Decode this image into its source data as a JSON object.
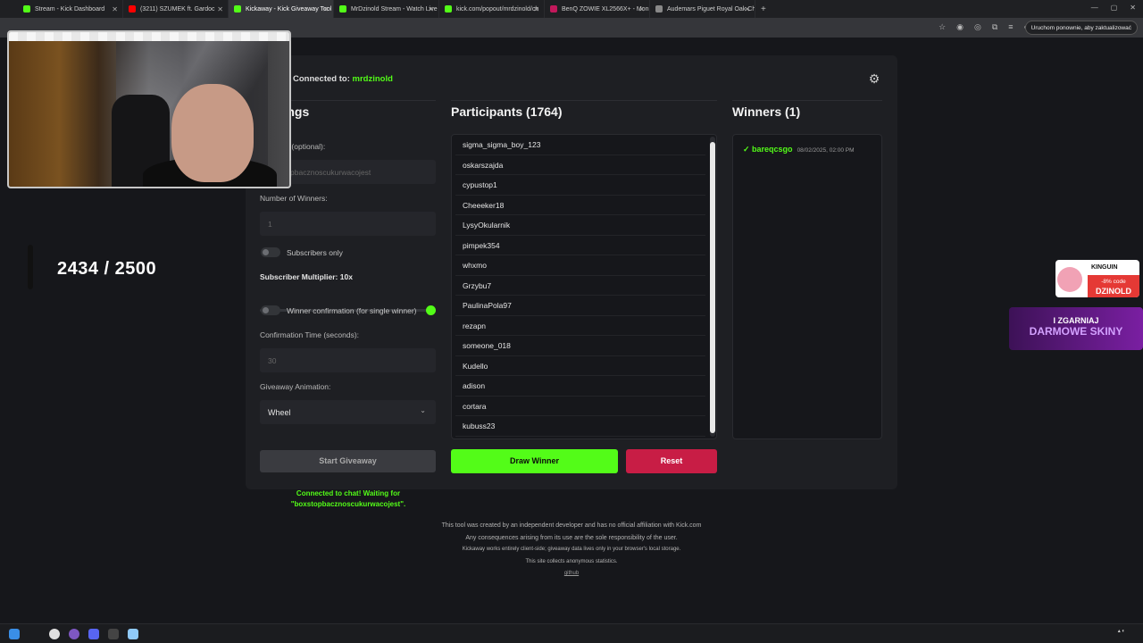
{
  "browser": {
    "tabs": [
      {
        "label": "Stream - Kick Dashboard",
        "color": "#53fc18",
        "active": false
      },
      {
        "label": "(3211) SZUMEK ft. Gardoc",
        "color": "#ff0000",
        "active": false
      },
      {
        "label": "Kickaway - Kick Giveaway Tool",
        "color": "#53fc18",
        "active": true
      },
      {
        "label": "MrDzinold Stream - Watch Live",
        "color": "#53fc18",
        "active": false
      },
      {
        "label": "kick.com/popout/mrdzinold/ch",
        "color": "#53fc18",
        "active": false
      },
      {
        "label": "BenQ ZOWIE XL2566X+ - Moni",
        "color": "#c2185b",
        "active": false
      },
      {
        "label": "Audemars Piguet Royal Oak Ch",
        "color": "#888888",
        "active": false
      }
    ],
    "update_button": "Uruchom ponownie, aby zaktualizować"
  },
  "app": {
    "connected_prefix": "Connected to: ",
    "channel": "mrdzinold",
    "settings_title": "Settings",
    "keyword_label": "Keyword (optional):",
    "keyword_value": "boxstopbacznoscukurwacojest",
    "winners_label": "Number of Winners:",
    "winners_value": "1",
    "subscribers_only": "Subscribers only",
    "multiplier_label": "Subscriber Multiplier: 10x",
    "multiplier_fraction": 1.0,
    "winner_confirmation": "Winner confirmation (for single winner)",
    "confirmation_time_label": "Confirmation Time (seconds):",
    "confirmation_time_value": "30",
    "animation_label": "Giveaway Animation:",
    "animation_value": "Wheel",
    "start_button": "Start Giveaway",
    "status": "Connected to chat! Waiting for \"boxstopbacznoscukurwacojest\".",
    "participants_title": "Participants (1764)",
    "participants": [
      "sigma_sigma_boy_123",
      "oskarszajda",
      "cypustop1",
      "Cheeeker18",
      "LysyOkularnik",
      "pimpek354",
      "whxmo",
      "Grzybu7",
      "PaulinaPola97",
      "rezapn",
      "someone_018",
      "Kudello",
      "adison",
      "cortara",
      "kubuss23"
    ],
    "draw_button": "Draw Winner",
    "reset_button": "Reset",
    "winners_title": "Winners (1)",
    "winners": [
      {
        "name": "✓ bareqcsgo",
        "time": "08/02/2025, 02:00 PM"
      }
    ]
  },
  "footer": {
    "line1": "This tool was created by an independent developer and has no official affiliation with Kick.com",
    "line2": "Any consequences arising from its use are the sole responsibility of the user.",
    "line3": "Kickaway works entirely client-side; giveaway data lives only in your browser's local storage.",
    "line4": "This site collects anonymous statistics.",
    "link": "github"
  },
  "overlay": {
    "counter": "2434 / 2500",
    "promo1_brand": "KINGUIN",
    "promo1_discount": "-8% code",
    "promo1_code": "DZINOLD",
    "promo2_line1": "I ZGARNIAJ",
    "promo2_line2": "DARMOWE SKINY"
  }
}
